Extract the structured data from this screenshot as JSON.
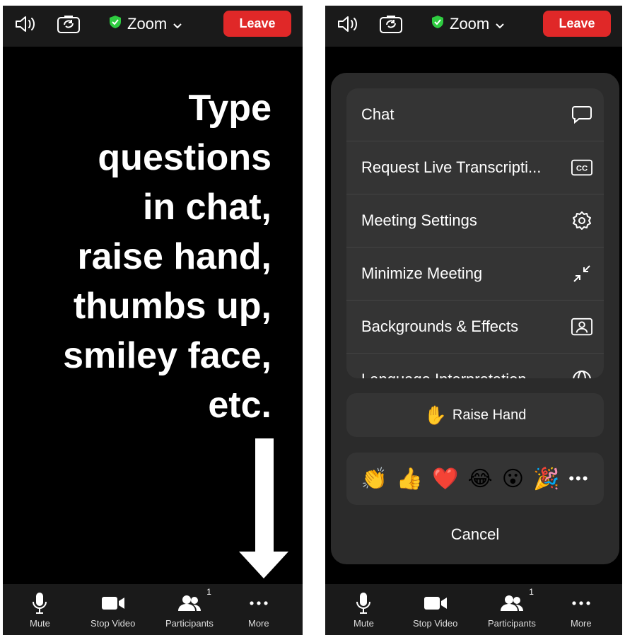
{
  "topbar": {
    "title": "Zoom",
    "leave_label": "Leave"
  },
  "left_panel": {
    "message": "Type\nquestions\nin chat,\nraise hand,\nthumbs up,\nsmiley face,\netc."
  },
  "toolbar": {
    "mute_label": "Mute",
    "stop_video_label": "Stop Video",
    "participants_label": "Participants",
    "participants_count": "1",
    "more_label": "More"
  },
  "menu": {
    "items": [
      {
        "label": "Chat",
        "icon": "chat-bubble-icon"
      },
      {
        "label": "Request Live Transcripti...",
        "icon": "cc-icon"
      },
      {
        "label": "Meeting Settings",
        "icon": "gear-icon"
      },
      {
        "label": "Minimize Meeting",
        "icon": "minimize-icon"
      },
      {
        "label": "Backgrounds & Effects",
        "icon": "person-frame-icon"
      },
      {
        "label": "Language Interpretation",
        "icon": "globe-icon"
      }
    ],
    "raise_hand_label": "Raise Hand",
    "reactions": [
      "👏",
      "👍",
      "❤️",
      "😂",
      "😮",
      "🎉"
    ],
    "reactions_more": "•••",
    "cancel_label": "Cancel"
  },
  "colors": {
    "leave": "#e02828",
    "shield": "#2ecc40",
    "background": "#000000",
    "sheet": "#2b2b2b"
  }
}
